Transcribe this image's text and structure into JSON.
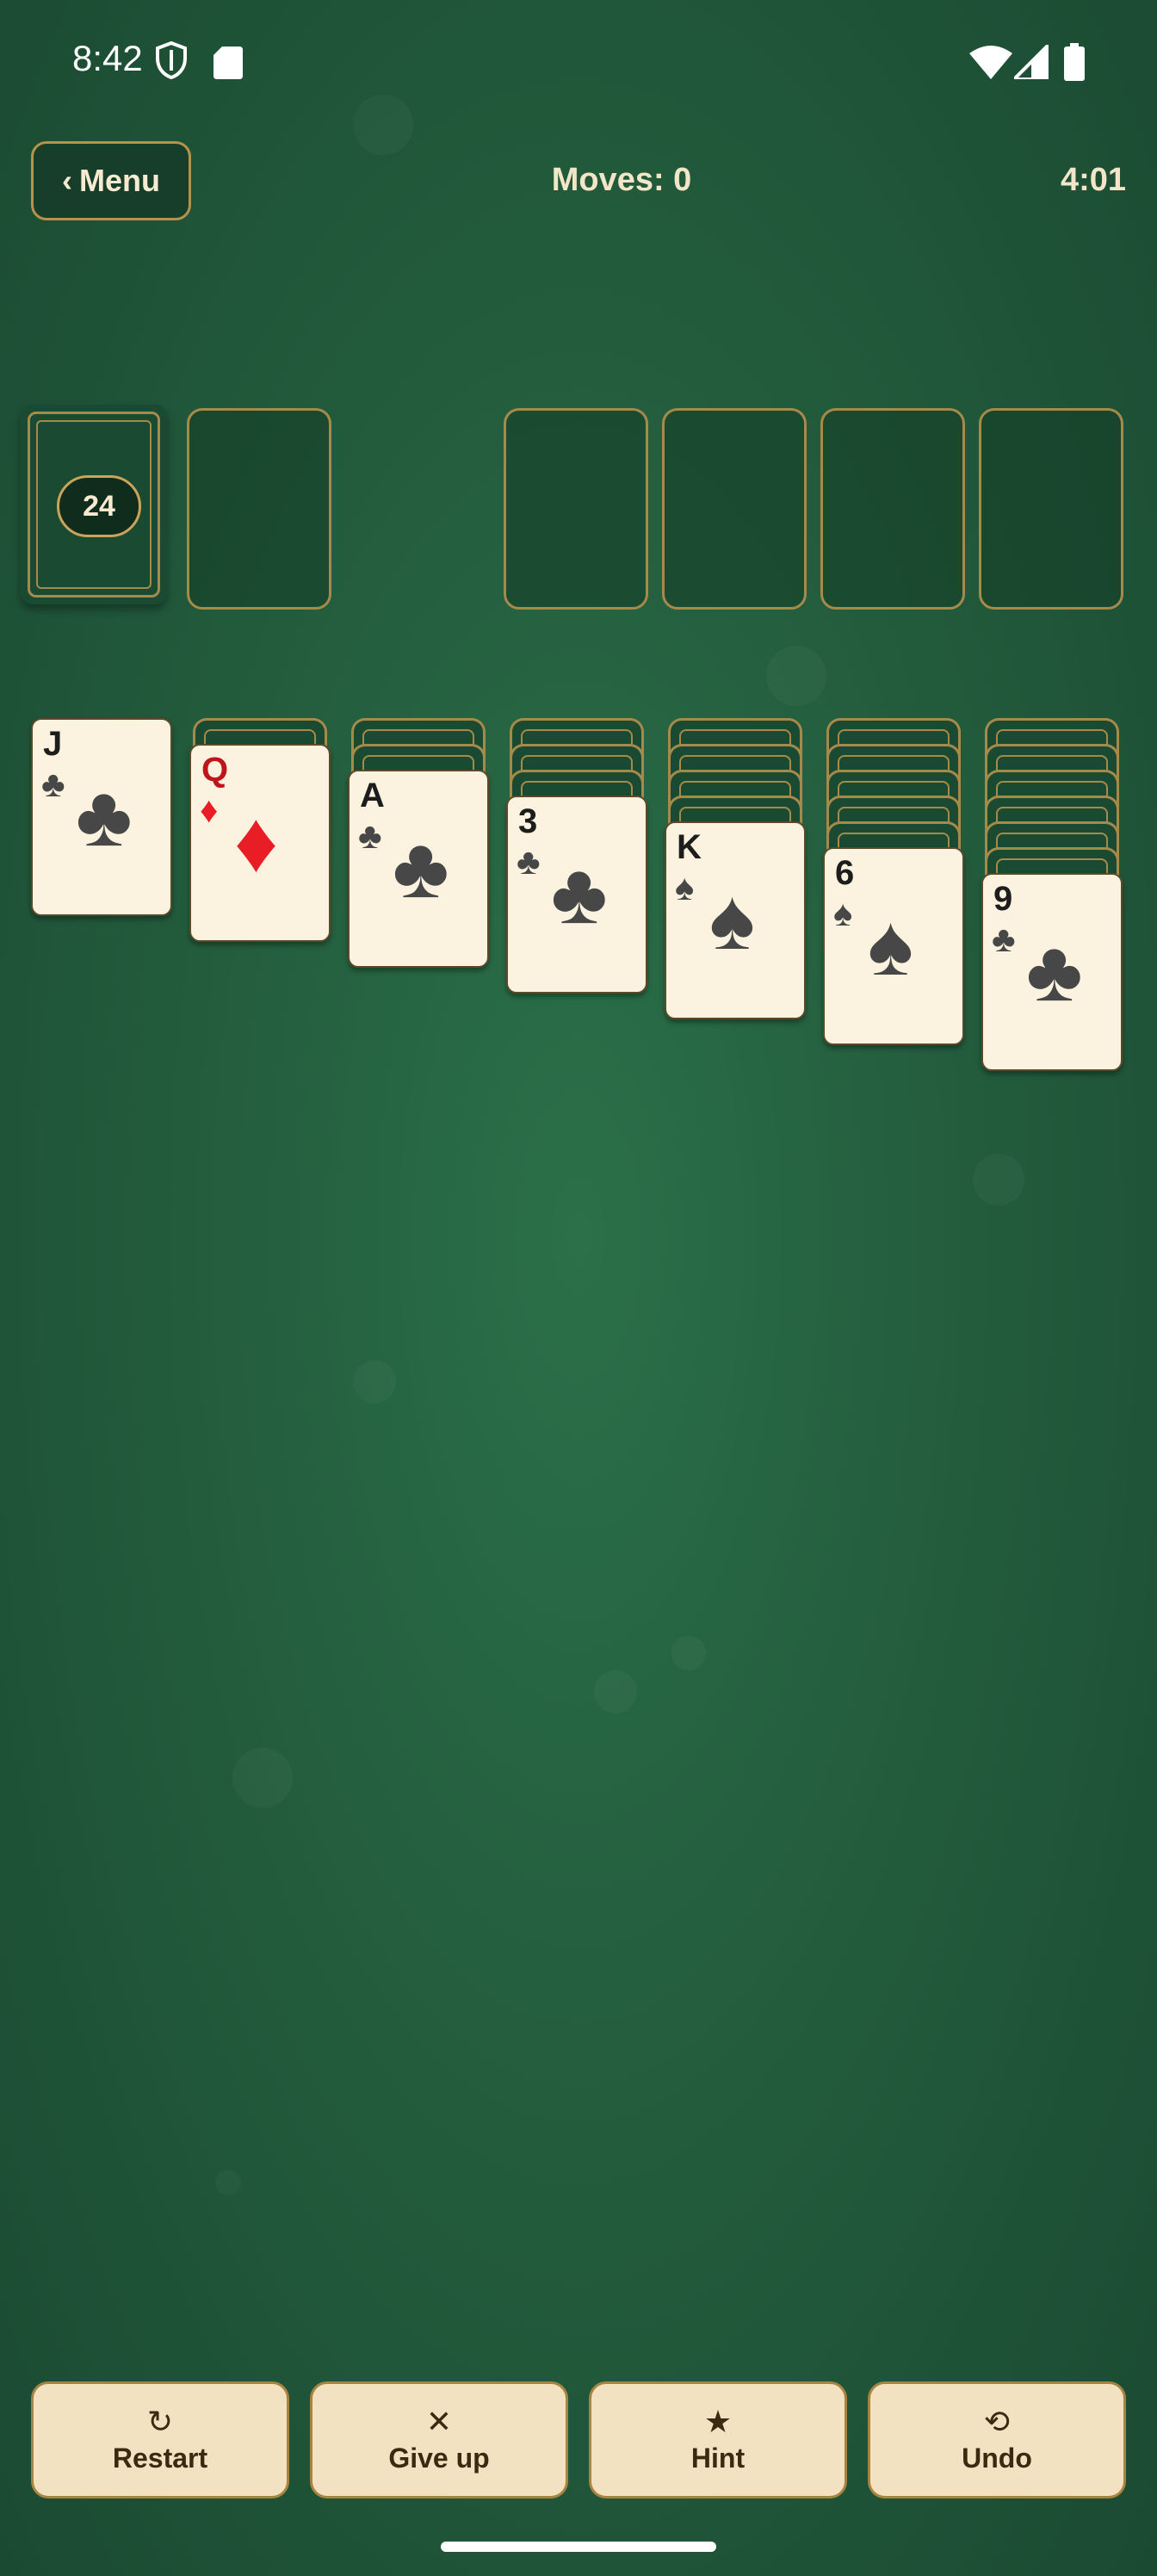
{
  "status_bar": {
    "time": "8:42",
    "icons": [
      "shield-icon",
      "sd-card-icon",
      "wifi-icon",
      "signal-icon",
      "battery-icon"
    ]
  },
  "header": {
    "menu_label": "Menu",
    "menu_chevron": "‹",
    "moves_label": "Moves: 0",
    "timer": "4:01"
  },
  "stock": {
    "count": "24"
  },
  "tableau": [
    {
      "rank": "J",
      "suit": "♣",
      "color": "black"
    },
    {
      "rank": "Q",
      "suit": "♦",
      "color": "red"
    },
    {
      "rank": "A",
      "suit": "♣",
      "color": "black"
    },
    {
      "rank": "3",
      "suit": "♣",
      "color": "black"
    },
    {
      "rank": "K",
      "suit": "♠",
      "color": "black"
    },
    {
      "rank": "6",
      "suit": "♠",
      "color": "black"
    },
    {
      "rank": "9",
      "suit": "♣",
      "color": "black"
    }
  ],
  "actions": {
    "restart": {
      "icon": "↻",
      "label": "Restart"
    },
    "give_up": {
      "icon": "✕",
      "label": "Give up"
    },
    "hint": {
      "icon": "★",
      "label": "Hint"
    },
    "undo": {
      "icon": "⟲",
      "label": "Undo"
    }
  },
  "colors": {
    "felt": "#22583b",
    "gold": "#a58a4a",
    "card_face": "#fbf3e0",
    "button": "#f3e2c2"
  }
}
